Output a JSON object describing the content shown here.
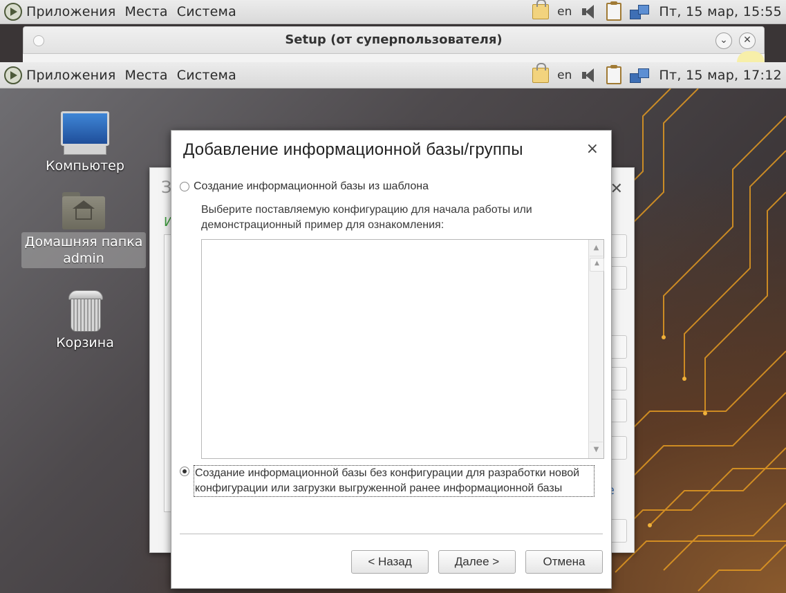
{
  "top_panel": {
    "menus": [
      "Приложения",
      "Места",
      "Система"
    ],
    "lang": "en",
    "clock": "Пт, 15 мар, 15:55"
  },
  "setup_window": {
    "title": "Setup (от суперпользователя)"
  },
  "inner_panel": {
    "menus": [
      "Приложения",
      "Места",
      "Система"
    ],
    "lang": "en",
    "clock": "Пт, 15 мар, 17:12"
  },
  "desktop_icons": [
    {
      "label": "Компьютер",
      "icon": "computer-icon"
    },
    {
      "label": "Домашняя папка admin",
      "icon": "home-folder-icon"
    },
    {
      "label": "Корзина",
      "icon": "trash-icon"
    }
  ],
  "back_window": {
    "title_fragment": "З",
    "label_fragment": "И",
    "link_fragment": "е"
  },
  "dialog": {
    "title": "Добавление информационной базы/группы",
    "close": "×",
    "option1": "Создание информационной базы из шаблона",
    "hint": "Выберите поставляемую конфигурацию для начала работы или демонстрационный пример для ознакомления:",
    "option2": "Создание информационной базы без конфигурации для разработки новой конфигурации или загрузки выгруженной ранее информационной базы",
    "selected_option": 2,
    "buttons": {
      "back": "< Назад",
      "next": "Далее >",
      "cancel": "Отмена"
    }
  },
  "colors": {
    "panel": "#e4e4e4",
    "accent_lines": "#e8a020",
    "dialog_bg": "#ffffff"
  }
}
